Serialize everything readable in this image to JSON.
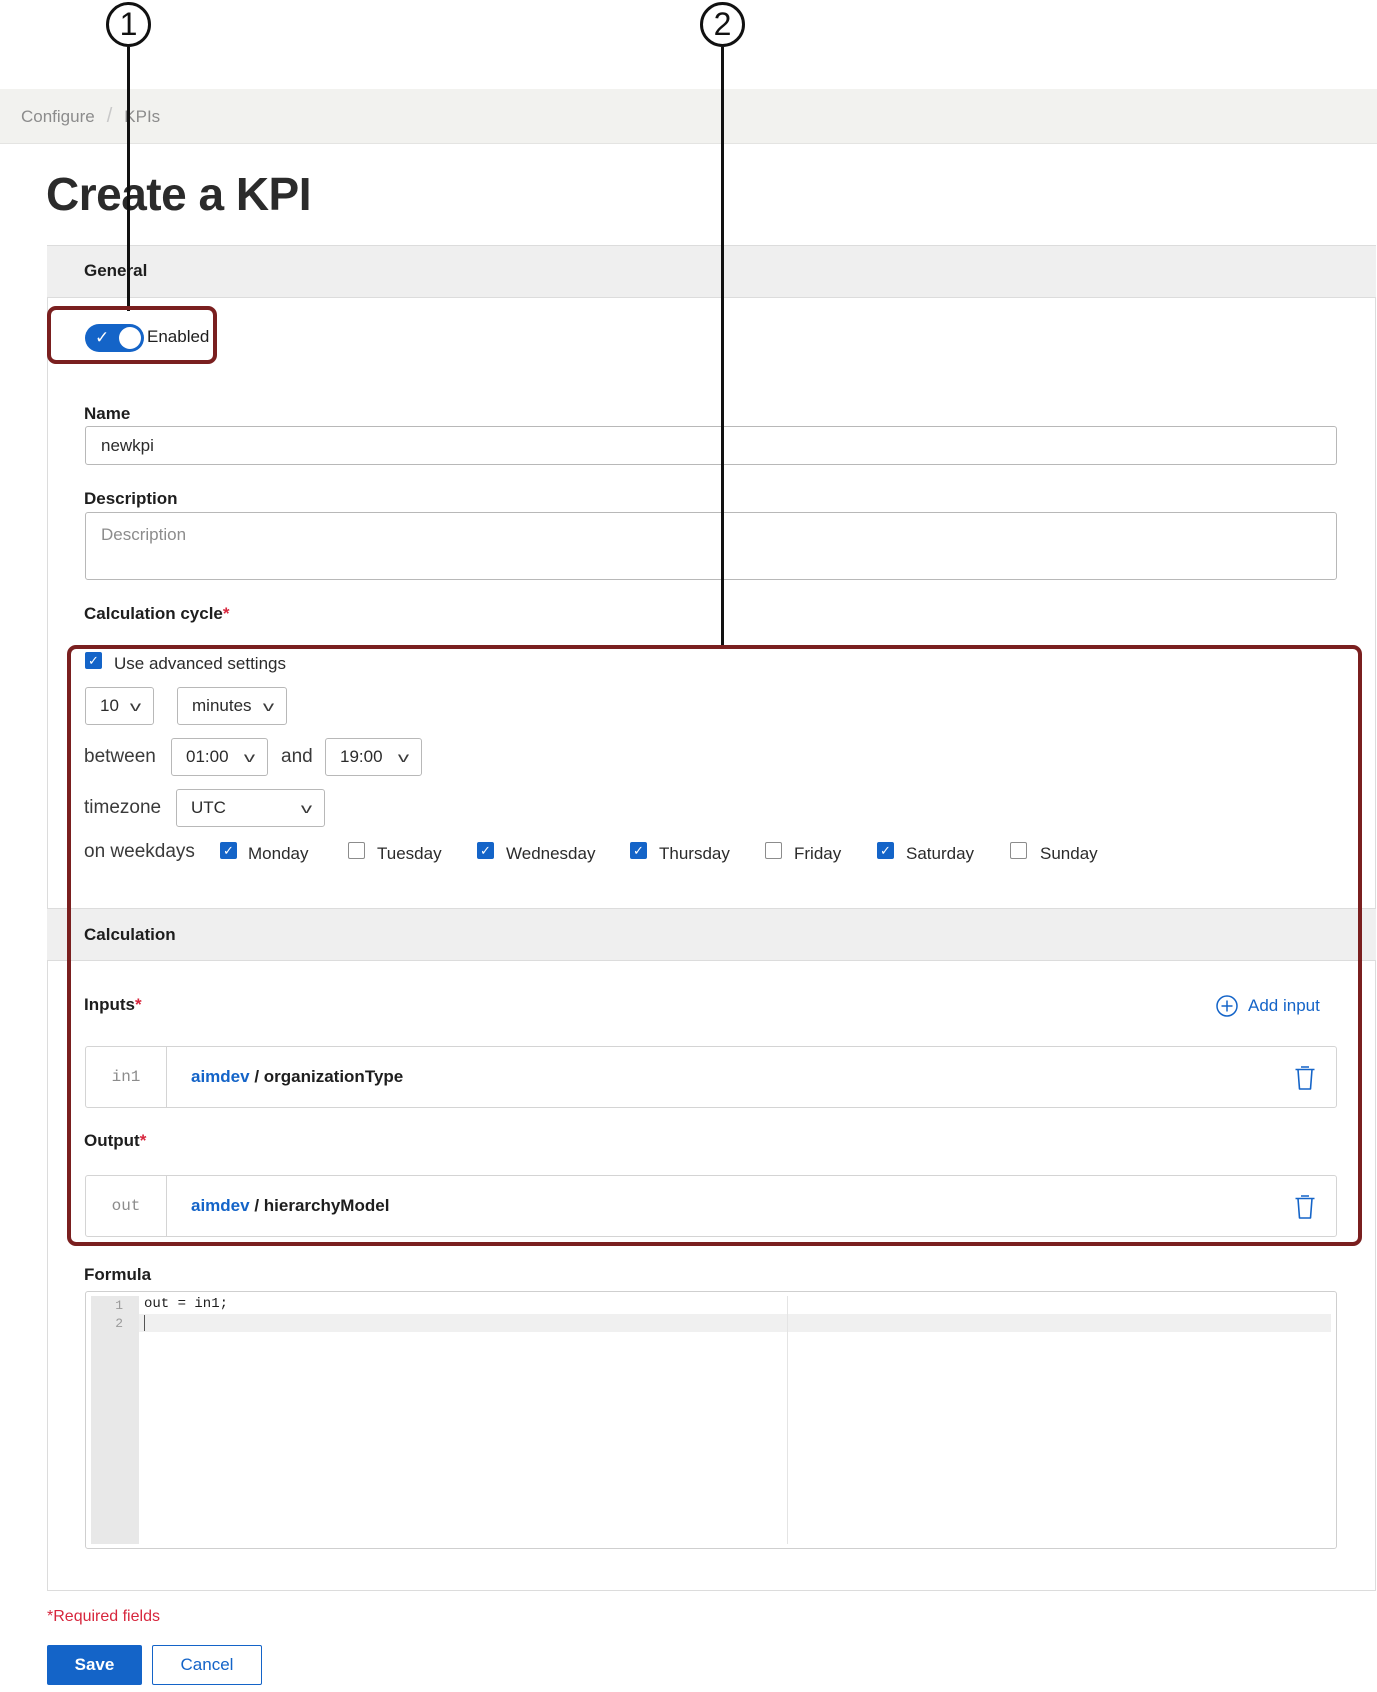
{
  "callouts": {
    "one": "1",
    "two": "2"
  },
  "breadcrumb": {
    "configure": "Configure",
    "kpis": "KPIs"
  },
  "page_title": "Create a KPI",
  "general": {
    "title": "General",
    "enabled_label": "Enabled",
    "enabled": true,
    "name_label": "Name",
    "name_value": "newkpi",
    "description_label": "Description",
    "description_placeholder": "Description",
    "calc_cycle_label": "Calculation cycle",
    "required_mark": "*"
  },
  "advanced": {
    "use_advanced_label": "Use advanced settings",
    "use_advanced_checked": true,
    "interval_value": "10",
    "interval_unit": "minutes",
    "between_label": "between",
    "start_time": "01:00",
    "and_label": "and",
    "end_time": "19:00",
    "timezone_label": "timezone",
    "timezone_value": "UTC",
    "weekdays_label": "on weekdays",
    "weekdays": [
      {
        "label": "Monday",
        "checked": true
      },
      {
        "label": "Tuesday",
        "checked": false
      },
      {
        "label": "Wednesday",
        "checked": true
      },
      {
        "label": "Thursday",
        "checked": true
      },
      {
        "label": "Friday",
        "checked": false
      },
      {
        "label": "Saturday",
        "checked": true
      },
      {
        "label": "Sunday",
        "checked": false
      }
    ]
  },
  "calculation": {
    "title": "Calculation",
    "inputs_label": "Inputs",
    "add_input_label": "Add input",
    "input_row": {
      "var": "in1",
      "tenant": "aimdev",
      "sep": " / ",
      "name": "organizationType"
    },
    "output_label": "Output",
    "output_row": {
      "var": "out",
      "tenant": "aimdev",
      "sep": " / ",
      "name": "hierarchyModel"
    },
    "formula_label": "Formula",
    "code_lines": [
      "out = in1;",
      ""
    ],
    "line_numbers": [
      "1",
      "2"
    ]
  },
  "footer": {
    "required_note_mark": "*",
    "required_note": "Required fields",
    "save_label": "Save",
    "cancel_label": "Cancel"
  },
  "colors": {
    "accent": "#1464c8",
    "required": "#d7263d",
    "callout_border": "#7a1f1f"
  }
}
